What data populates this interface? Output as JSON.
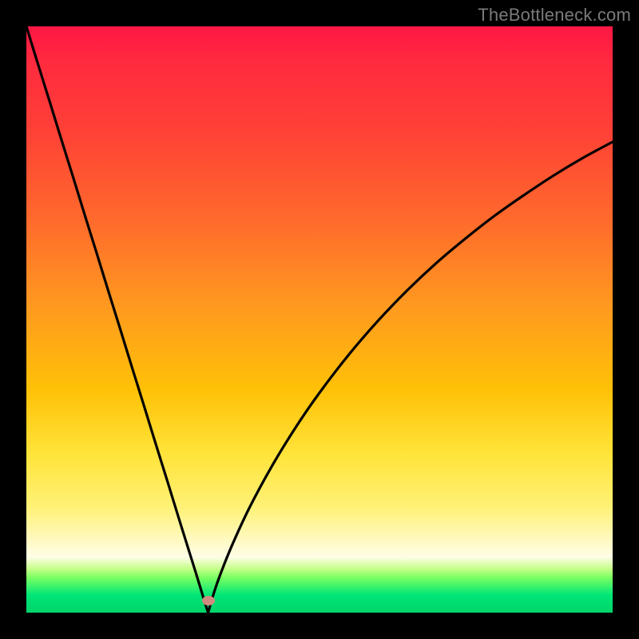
{
  "watermark": "TheBottleneck.com",
  "colors": {
    "frame": "#000000",
    "gradient_top": "#ff1744",
    "gradient_mid1": "#ff9a1f",
    "gradient_mid2": "#ffe43a",
    "gradient_bottom": "#00e676",
    "curve": "#000000",
    "marker": "#cf8b80",
    "watermark": "#7a7a7a"
  },
  "chart_data": {
    "type": "line",
    "title": "",
    "xlabel": "",
    "ylabel": "",
    "xlim": [
      0,
      100
    ],
    "ylim": [
      0,
      100
    ],
    "grid": false,
    "legend": false,
    "notch_x": 31,
    "marker": {
      "x": 31,
      "y": 2
    },
    "series": [
      {
        "name": "bottleneck-curve",
        "x": [
          0,
          2,
          4,
          6,
          8,
          10,
          12,
          14,
          16,
          18,
          20,
          22,
          24,
          26,
          27,
          28,
          29,
          30,
          31,
          32,
          33,
          35,
          38,
          42,
          46,
          50,
          55,
          60,
          65,
          70,
          75,
          80,
          85,
          90,
          95,
          100
        ],
        "y": [
          100,
          93.5,
          87.1,
          80.6,
          74.2,
          67.7,
          61.3,
          54.8,
          48.4,
          41.9,
          35.5,
          29.0,
          22.6,
          16.1,
          12.9,
          9.7,
          6.5,
          3.2,
          0.0,
          3.4,
          6.3,
          11.3,
          17.8,
          25.2,
          31.7,
          37.5,
          44.0,
          49.8,
          55.0,
          59.7,
          63.9,
          67.8,
          71.3,
          74.6,
          77.6,
          80.3
        ]
      }
    ]
  }
}
